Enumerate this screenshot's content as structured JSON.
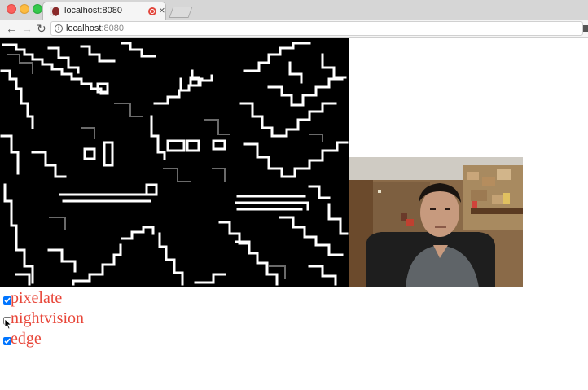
{
  "browser": {
    "tab_title": "localhost:8080",
    "tab_close": "×",
    "url_host": "localhost",
    "url_port": ":8080",
    "nav": {
      "back": "←",
      "forward": "→",
      "reload": "↻"
    },
    "info_glyph": "i"
  },
  "controls": [
    {
      "label": "pixelate",
      "checked": true
    },
    {
      "label": "nightvision",
      "checked": false
    },
    {
      "label": "edge",
      "checked": true
    }
  ],
  "colors": {
    "label_color": "#e8473a",
    "accent_record": "#e2473d"
  }
}
